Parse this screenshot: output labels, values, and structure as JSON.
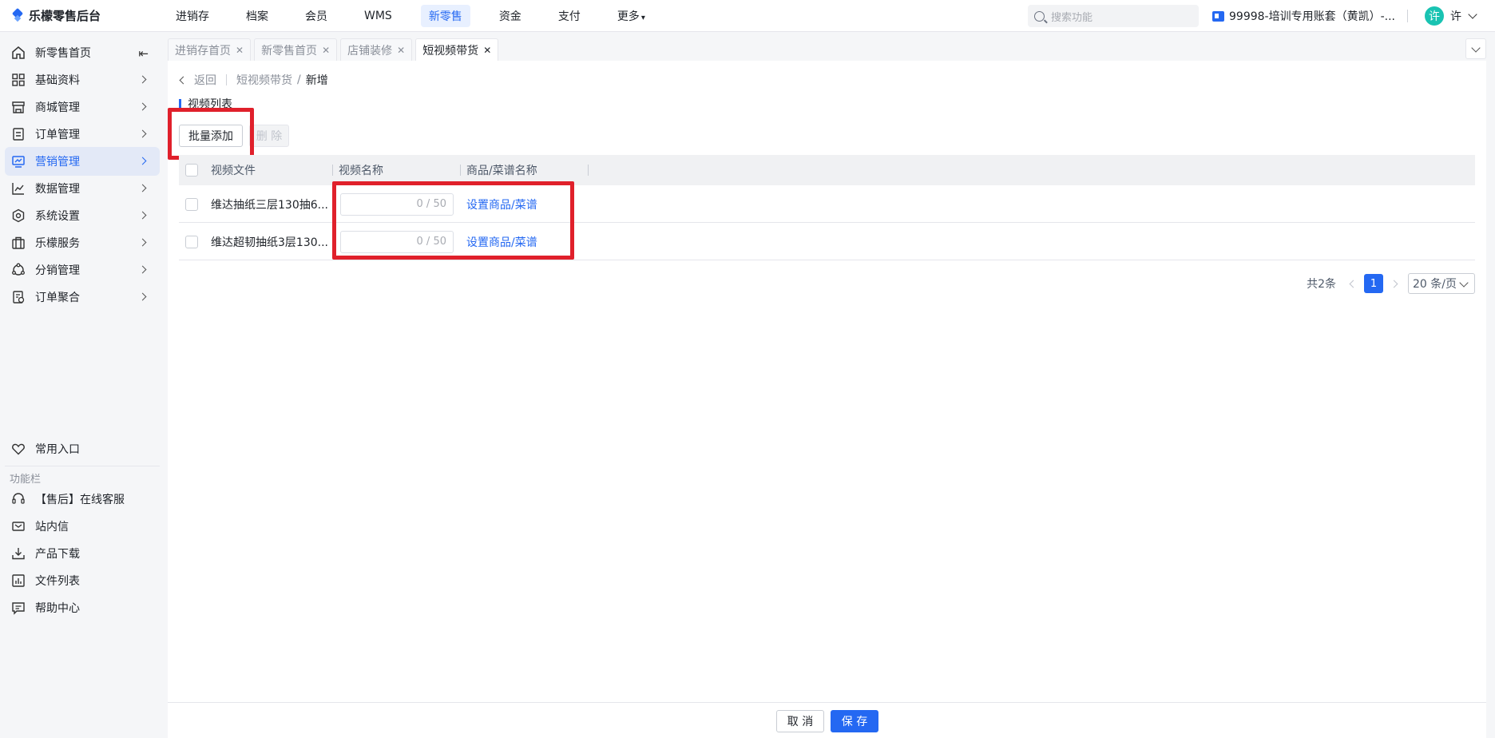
{
  "app": {
    "title": "乐檬零售后台"
  },
  "topnav": [
    "进销存",
    "档案",
    "会员",
    "WMS",
    "新零售",
    "资金",
    "支付",
    "更多"
  ],
  "topnav_active": 4,
  "search": {
    "placeholder": "搜索功能"
  },
  "account": {
    "name": "99998-培训专用账套（黄凯）-..."
  },
  "user": {
    "avatar": "许",
    "name": "许"
  },
  "sidebar": {
    "items": [
      {
        "label": "新零售首页",
        "icon": "home-icon"
      },
      {
        "label": "基础资料",
        "icon": "grid-icon"
      },
      {
        "label": "商城管理",
        "icon": "store-icon"
      },
      {
        "label": "订单管理",
        "icon": "order-icon"
      },
      {
        "label": "营销管理",
        "icon": "marketing-icon"
      },
      {
        "label": "数据管理",
        "icon": "chart-line-icon"
      },
      {
        "label": "系统设置",
        "icon": "settings-icon"
      },
      {
        "label": "乐檬服务",
        "icon": "briefcase-icon"
      },
      {
        "label": "分销管理",
        "icon": "distribution-icon"
      },
      {
        "label": "订单聚合",
        "icon": "order-aggregate-icon"
      }
    ],
    "active": 4,
    "favorites": "常用入口",
    "section_title": "功能栏",
    "tools": [
      {
        "label": "【售后】在线客服",
        "icon": "headset-icon"
      },
      {
        "label": "站内信",
        "icon": "mail-icon"
      },
      {
        "label": "产品下载",
        "icon": "download-icon"
      },
      {
        "label": "文件列表",
        "icon": "file-list-icon"
      },
      {
        "label": "帮助中心",
        "icon": "help-icon"
      }
    ]
  },
  "tabs": [
    {
      "label": "进销存首页"
    },
    {
      "label": "新零售首页"
    },
    {
      "label": "店铺装修"
    },
    {
      "label": "短视频带货"
    }
  ],
  "tabs_active": 3,
  "breadcrumb": {
    "back": "返回",
    "parent": "短视频带货",
    "separator": "/",
    "current": "新增"
  },
  "section": {
    "title": "视频列表"
  },
  "actions": {
    "batch_add": "批量添加",
    "delete": "删 除"
  },
  "table": {
    "columns": [
      "视频文件",
      "视频名称",
      "商品/菜谱名称"
    ],
    "rows": [
      {
        "file": "维达抽纸三层130抽6...",
        "name_counter": "0 / 50",
        "link": "设置商品/菜谱"
      },
      {
        "file": "维达超韧抽纸3层130...",
        "name_counter": "0 / 50",
        "link": "设置商品/菜谱"
      }
    ]
  },
  "pagination": {
    "total": "共2条",
    "current": "1",
    "page_size": "20 条/页"
  },
  "footer": {
    "cancel": "取 消",
    "save": "保 存"
  },
  "colors": {
    "accent": "#2468f2",
    "highlight": "#e0202b"
  }
}
